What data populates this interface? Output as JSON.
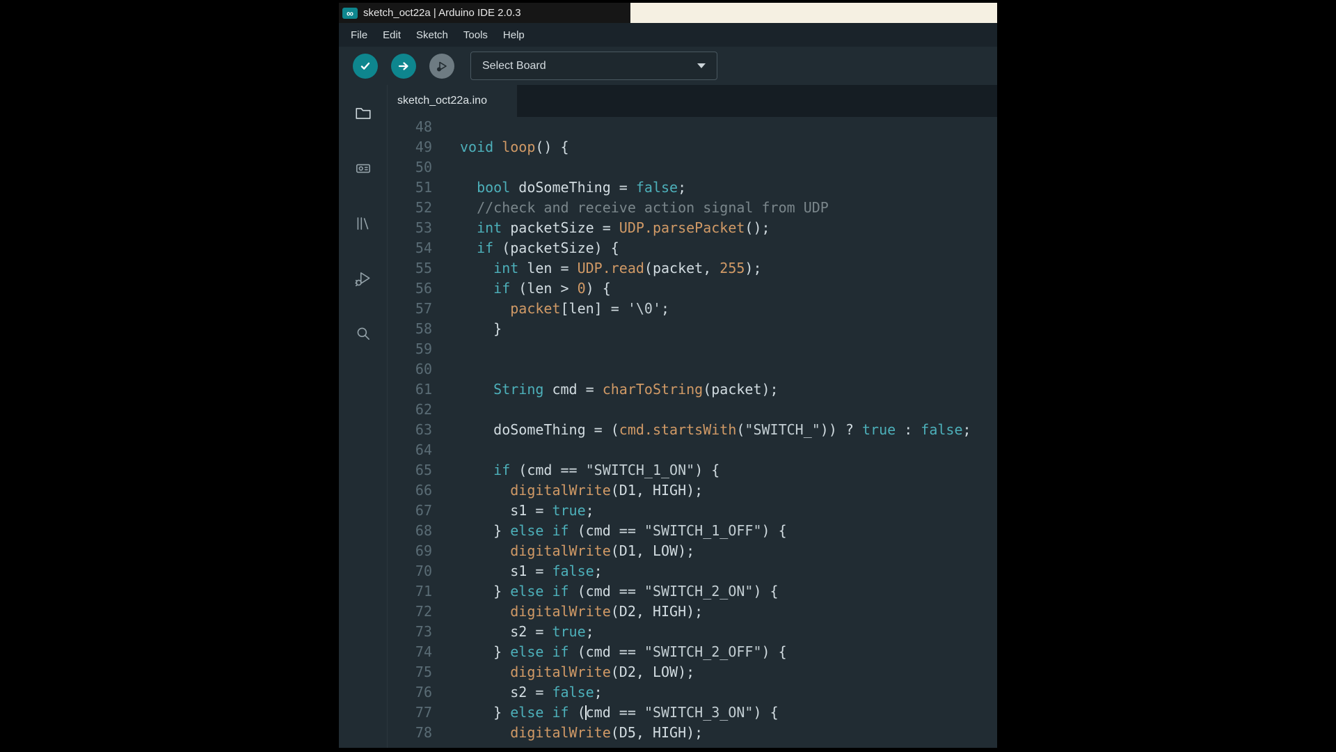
{
  "window": {
    "title": "sketch_oct22a | Arduino IDE 2.0.3",
    "logo_glyph": "∞"
  },
  "menu": {
    "items": [
      "File",
      "Edit",
      "Sketch",
      "Tools",
      "Help"
    ]
  },
  "toolbar": {
    "board_selector_label": "Select Board",
    "buttons": [
      {
        "name": "verify",
        "disabled": false
      },
      {
        "name": "upload",
        "disabled": false
      },
      {
        "name": "debug",
        "disabled": true
      }
    ]
  },
  "sidebar": {
    "items": [
      {
        "name": "sketchbook",
        "icon": "folder-icon",
        "active": true
      },
      {
        "name": "boards-manager",
        "icon": "board-icon",
        "active": false
      },
      {
        "name": "library-manager",
        "icon": "library-icon",
        "active": false
      },
      {
        "name": "debug",
        "icon": "debug-icon",
        "active": false
      },
      {
        "name": "search",
        "icon": "search-icon",
        "active": false
      }
    ]
  },
  "tabs": [
    {
      "label": "sketch_oct22a.ino",
      "active": true
    }
  ],
  "colors": {
    "accent_teal": "#0e868e",
    "titlebar_bg": "#161616",
    "menubar_bg": "#1a232a",
    "chrome_bg": "#212c33",
    "tabbar_bg": "#151d23",
    "editor_bg": "#212c33",
    "gutter_text": "#5a6c75",
    "text": "#d2dce1",
    "keyword": "#4db0ba",
    "function": "#d19a66",
    "string": "#c3ced3",
    "comment": "#7a868b",
    "number": "#d19a66",
    "border": "#4a5860",
    "background_strip": "#f5f0e2",
    "icon": "#93a1a8"
  },
  "editor": {
    "lines": [
      {
        "num": 48,
        "segs": []
      },
      {
        "num": 49,
        "segs": [
          {
            "t": "void ",
            "c": "k"
          },
          {
            "t": "loop",
            "c": "f"
          },
          {
            "t": "() {",
            "c": "d"
          }
        ]
      },
      {
        "num": 50,
        "segs": []
      },
      {
        "num": 51,
        "segs": [
          {
            "t": "  ",
            "c": "d"
          },
          {
            "t": "bool",
            "c": "k"
          },
          {
            "t": " doSomeThing = ",
            "c": "d"
          },
          {
            "t": "false",
            "c": "k"
          },
          {
            "t": ";",
            "c": "d"
          }
        ]
      },
      {
        "num": 52,
        "segs": [
          {
            "t": "  ",
            "c": "d"
          },
          {
            "t": "//check and receive action signal from UDP",
            "c": "c"
          }
        ]
      },
      {
        "num": 53,
        "segs": [
          {
            "t": "  ",
            "c": "d"
          },
          {
            "t": "int",
            "c": "k"
          },
          {
            "t": " packetSize = ",
            "c": "d"
          },
          {
            "t": "UDP.parsePacket",
            "c": "f"
          },
          {
            "t": "();",
            "c": "d"
          }
        ]
      },
      {
        "num": 54,
        "segs": [
          {
            "t": "  ",
            "c": "d"
          },
          {
            "t": "if",
            "c": "k"
          },
          {
            "t": " (packetSize) {",
            "c": "d"
          }
        ]
      },
      {
        "num": 55,
        "segs": [
          {
            "t": "    ",
            "c": "d"
          },
          {
            "t": "int",
            "c": "k"
          },
          {
            "t": " len = ",
            "c": "d"
          },
          {
            "t": "UDP.read",
            "c": "f"
          },
          {
            "t": "(packet, ",
            "c": "d"
          },
          {
            "t": "255",
            "c": "n"
          },
          {
            "t": ");",
            "c": "d"
          }
        ]
      },
      {
        "num": 56,
        "segs": [
          {
            "t": "    ",
            "c": "d"
          },
          {
            "t": "if",
            "c": "k"
          },
          {
            "t": " (len > ",
            "c": "d"
          },
          {
            "t": "0",
            "c": "n"
          },
          {
            "t": ") {",
            "c": "d"
          }
        ]
      },
      {
        "num": 57,
        "segs": [
          {
            "t": "      ",
            "c": "d"
          },
          {
            "t": "packet",
            "c": "f"
          },
          {
            "t": "[len] = ",
            "c": "d"
          },
          {
            "t": "'\\0'",
            "c": "s"
          },
          {
            "t": ";",
            "c": "d"
          }
        ]
      },
      {
        "num": 58,
        "segs": [
          {
            "t": "    }",
            "c": "d"
          }
        ]
      },
      {
        "num": 59,
        "segs": []
      },
      {
        "num": 60,
        "segs": []
      },
      {
        "num": 61,
        "segs": [
          {
            "t": "    ",
            "c": "d"
          },
          {
            "t": "String",
            "c": "k"
          },
          {
            "t": " cmd = ",
            "c": "d"
          },
          {
            "t": "charToString",
            "c": "f"
          },
          {
            "t": "(packet);",
            "c": "d"
          }
        ]
      },
      {
        "num": 62,
        "segs": []
      },
      {
        "num": 63,
        "segs": [
          {
            "t": "    doSomeThing = (",
            "c": "d"
          },
          {
            "t": "cmd.startsWith",
            "c": "f"
          },
          {
            "t": "(",
            "c": "d"
          },
          {
            "t": "\"SWITCH_\"",
            "c": "s"
          },
          {
            "t": ")) ? ",
            "c": "d"
          },
          {
            "t": "true",
            "c": "k"
          },
          {
            "t": " : ",
            "c": "d"
          },
          {
            "t": "false",
            "c": "k"
          },
          {
            "t": ";",
            "c": "d"
          }
        ]
      },
      {
        "num": 64,
        "segs": []
      },
      {
        "num": 65,
        "segs": [
          {
            "t": "    ",
            "c": "d"
          },
          {
            "t": "if",
            "c": "k"
          },
          {
            "t": " (cmd == ",
            "c": "d"
          },
          {
            "t": "\"SWITCH_1_ON\"",
            "c": "s"
          },
          {
            "t": ") {",
            "c": "d"
          }
        ]
      },
      {
        "num": 66,
        "segs": [
          {
            "t": "      ",
            "c": "d"
          },
          {
            "t": "digitalWrite",
            "c": "f"
          },
          {
            "t": "(D1, HIGH);",
            "c": "d"
          }
        ]
      },
      {
        "num": 67,
        "segs": [
          {
            "t": "      s1 = ",
            "c": "d"
          },
          {
            "t": "true",
            "c": "k"
          },
          {
            "t": ";",
            "c": "d"
          }
        ]
      },
      {
        "num": 68,
        "segs": [
          {
            "t": "    } ",
            "c": "d"
          },
          {
            "t": "else if",
            "c": "k"
          },
          {
            "t": " (cmd == ",
            "c": "d"
          },
          {
            "t": "\"SWITCH_1_OFF\"",
            "c": "s"
          },
          {
            "t": ") {",
            "c": "d"
          }
        ]
      },
      {
        "num": 69,
        "segs": [
          {
            "t": "      ",
            "c": "d"
          },
          {
            "t": "digitalWrite",
            "c": "f"
          },
          {
            "t": "(D1, LOW);",
            "c": "d"
          }
        ]
      },
      {
        "num": 70,
        "segs": [
          {
            "t": "      s1 = ",
            "c": "d"
          },
          {
            "t": "false",
            "c": "k"
          },
          {
            "t": ";",
            "c": "d"
          }
        ]
      },
      {
        "num": 71,
        "segs": [
          {
            "t": "    } ",
            "c": "d"
          },
          {
            "t": "else if",
            "c": "k"
          },
          {
            "t": " (cmd == ",
            "c": "d"
          },
          {
            "t": "\"SWITCH_2_ON\"",
            "c": "s"
          },
          {
            "t": ") {",
            "c": "d"
          }
        ]
      },
      {
        "num": 72,
        "segs": [
          {
            "t": "      ",
            "c": "d"
          },
          {
            "t": "digitalWrite",
            "c": "f"
          },
          {
            "t": "(D2, HIGH);",
            "c": "d"
          }
        ]
      },
      {
        "num": 73,
        "segs": [
          {
            "t": "      s2 = ",
            "c": "d"
          },
          {
            "t": "true",
            "c": "k"
          },
          {
            "t": ";",
            "c": "d"
          }
        ]
      },
      {
        "num": 74,
        "segs": [
          {
            "t": "    } ",
            "c": "d"
          },
          {
            "t": "else if",
            "c": "k"
          },
          {
            "t": " (cmd == ",
            "c": "d"
          },
          {
            "t": "\"SWITCH_2_OFF\"",
            "c": "s"
          },
          {
            "t": ") {",
            "c": "d"
          }
        ]
      },
      {
        "num": 75,
        "segs": [
          {
            "t": "      ",
            "c": "d"
          },
          {
            "t": "digitalWrite",
            "c": "f"
          },
          {
            "t": "(D2, LOW);",
            "c": "d"
          }
        ]
      },
      {
        "num": 76,
        "segs": [
          {
            "t": "      s2 = ",
            "c": "d"
          },
          {
            "t": "false",
            "c": "k"
          },
          {
            "t": ";",
            "c": "d"
          }
        ]
      },
      {
        "num": 77,
        "segs": [
          {
            "t": "    } ",
            "c": "d"
          },
          {
            "t": "else if",
            "c": "k"
          },
          {
            "t": " (",
            "c": "d"
          },
          {
            "caret": true
          },
          {
            "t": "cmd == ",
            "c": "d"
          },
          {
            "t": "\"SWITCH_3_ON\"",
            "c": "s"
          },
          {
            "t": ") {",
            "c": "d"
          }
        ]
      },
      {
        "num": 78,
        "segs": [
          {
            "t": "      ",
            "c": "d"
          },
          {
            "t": "digitalWrite",
            "c": "f"
          },
          {
            "t": "(D5, HIGH);",
            "c": "d"
          }
        ]
      }
    ]
  }
}
